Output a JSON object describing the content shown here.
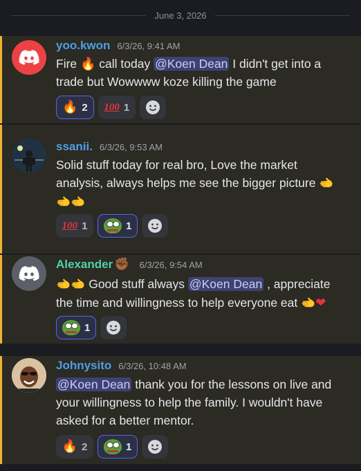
{
  "date_divider": "June 3, 2026",
  "messages": [
    {
      "username": "yoo.kwon",
      "timestamp": "6/3/26, 9:41 AM",
      "line1_pre": "Fire ",
      "line1_mid": " call today ",
      "mention": "@Koen Dean",
      "line1_post": " I didn't get into a",
      "line2": "trade but Wowwww koze killing the game",
      "reactions": [
        {
          "emoji": "fire",
          "count": "2",
          "active": true
        },
        {
          "emoji": "hundred",
          "count": "1",
          "active": false
        }
      ]
    },
    {
      "username": "ssanii.",
      "timestamp": "6/3/26, 9:53 AM",
      "line1": "Solid stuff today for real bro, Love the market",
      "line2": "analysis, always helps me see the bigger picture",
      "reactions": [
        {
          "emoji": "hundred",
          "count": "1",
          "active": false
        },
        {
          "emoji": "pepe",
          "count": "1",
          "active": true
        }
      ]
    },
    {
      "username": "Alexander",
      "timestamp": "6/3/26, 9:54 AM",
      "line1_pre": " Good stuff always ",
      "mention": "@Koen Dean",
      "line1_post": " , appreciate",
      "line2": "the time and willingness to help everyone eat",
      "reactions": [
        {
          "emoji": "pepe",
          "count": "1",
          "active": true
        }
      ]
    },
    {
      "username": "Johnysito",
      "timestamp": "6/3/26, 10:48 AM",
      "mention": "@Koen Dean",
      "line1_post": " thank you for the lessons on live and",
      "line2": "your willingness to help the family. I wouldn't have",
      "line3": "asked for a better mentor.",
      "reactions": [
        {
          "emoji": "fire",
          "count": "2",
          "active": false
        },
        {
          "emoji": "pepe",
          "count": "1",
          "active": true
        }
      ]
    }
  ],
  "icons": {
    "discord_logo": "discord-logo-icon",
    "add_reaction": "smiley-icon",
    "fire": "fire-icon",
    "hundred": "hundred-points-icon",
    "pepe": "pepe-frog-icon",
    "point_left": "point-left-icon",
    "fist": "raised-fist-icon",
    "heart": "red-heart-icon"
  }
}
